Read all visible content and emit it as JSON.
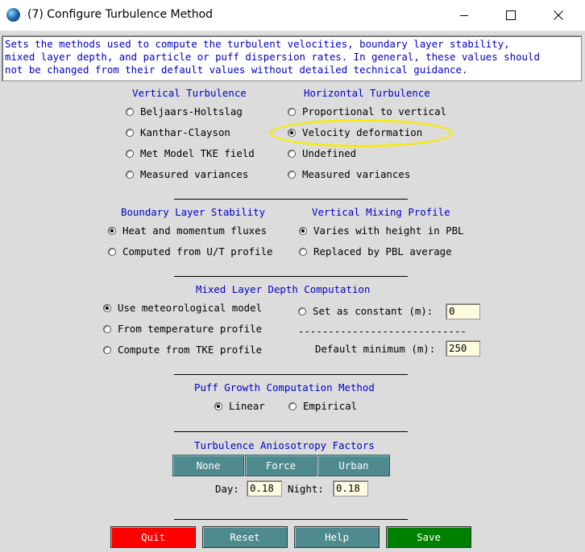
{
  "window": {
    "title": "(7) Configure Turbulence Method",
    "minimize_icon": "minimize-icon",
    "maximize_icon": "maximize-icon",
    "close_icon": "close-icon"
  },
  "info_text": "Sets the methods used to compute the turbulent velocities, boundary layer stability,\nmixed layer depth, and particle or puff dispersion rates. In general, these values should\nnot be changed from their default values without detailed technical guidance.",
  "vertical_turbulence": {
    "header": "Vertical Turbulence",
    "options": [
      {
        "label": "Beljaars-Holtslag",
        "selected": false
      },
      {
        "label": "Kanthar-Clayson",
        "selected": false
      },
      {
        "label": "Met Model TKE field",
        "selected": false
      },
      {
        "label": "Measured variances",
        "selected": false
      }
    ]
  },
  "horizontal_turbulence": {
    "header": "Horizontal Turbulence",
    "options": [
      {
        "label": "Proportional to vertical",
        "selected": false
      },
      {
        "label": "Velocity deformation",
        "selected": true
      },
      {
        "label": "Undefined",
        "selected": false
      },
      {
        "label": "Measured variances",
        "selected": false
      }
    ]
  },
  "boundary_layer_stability": {
    "header": "Boundary Layer Stability",
    "options": [
      {
        "label": "Heat and momentum fluxes",
        "selected": true
      },
      {
        "label": "Computed from U/T profile",
        "selected": false
      }
    ]
  },
  "vertical_mixing_profile": {
    "header": "Vertical Mixing Profile",
    "options": [
      {
        "label": "Varies with height in PBL",
        "selected": true
      },
      {
        "label": "Replaced by PBL average",
        "selected": false
      }
    ]
  },
  "mixed_layer_depth": {
    "header": "Mixed Layer Depth Computation",
    "options": [
      {
        "label": "Use meteorological model",
        "selected": true
      },
      {
        "label": "From temperature profile",
        "selected": false
      },
      {
        "label": "Compute from TKE profile",
        "selected": false
      }
    ],
    "constant_option": {
      "label": "Set as constant (m):",
      "selected": false
    },
    "constant_value": "0",
    "dashes": "----------------------------",
    "default_min_label": "Default minimum (m):",
    "default_min_value": "250"
  },
  "puff_growth": {
    "header": "Puff Growth Computation Method",
    "options": [
      {
        "label": "Linear",
        "selected": true
      },
      {
        "label": "Empirical",
        "selected": false
      }
    ]
  },
  "anisotropy": {
    "header": "Turbulence Aniosotropy Factors",
    "buttons": [
      "None",
      "Force",
      "Urban"
    ],
    "day_label": "Day:",
    "day_value": "0.18",
    "night_label": "Night:",
    "night_value": "0.18"
  },
  "actions": {
    "quit": "Quit",
    "reset": "Reset",
    "help": "Help",
    "save": "Save"
  },
  "colors": {
    "header_blue": "#0000c8",
    "panel_bg": "#dcdcdc",
    "field_bg": "#fffbe0",
    "teal_button": "#4f8a8e",
    "quit_red": "#ff0000",
    "save_green": "#008000",
    "highlight_yellow": "#f5ea14"
  }
}
